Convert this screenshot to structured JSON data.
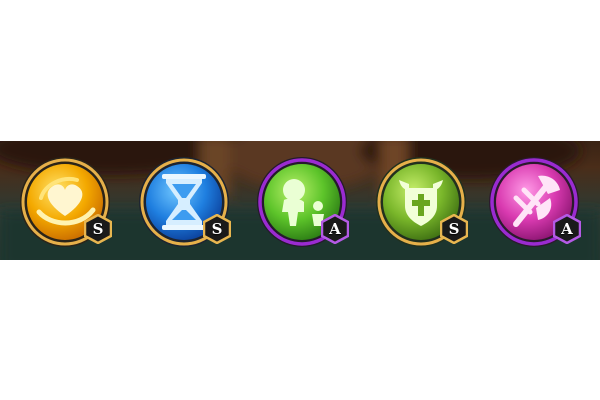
{
  "skills": [
    {
      "icon": "heart-swirl-icon",
      "rank": "S",
      "orb_color": "#f4a900",
      "ring_color": "#e6b04a",
      "badge_color": "#e8b650"
    },
    {
      "icon": "hourglass-icon",
      "rank": "S",
      "orb_color": "#1f7fe0",
      "ring_color": "#e6b04a",
      "badge_color": "#e8b650"
    },
    {
      "icon": "figure-and-minion-icon",
      "rank": "A",
      "orb_color": "#5dc42a",
      "ring_color": "#9a2bd1",
      "badge_color": "#b55ae6"
    },
    {
      "icon": "horned-shield-cross-icon",
      "rank": "S",
      "orb_color": "#79b62a",
      "ring_color": "#e6b04a",
      "badge_color": "#e8b650"
    },
    {
      "icon": "crossed-axe-icon",
      "rank": "A",
      "orb_color": "#d93ab0",
      "ring_color": "#9a2bd1",
      "badge_color": "#b55ae6"
    }
  ]
}
